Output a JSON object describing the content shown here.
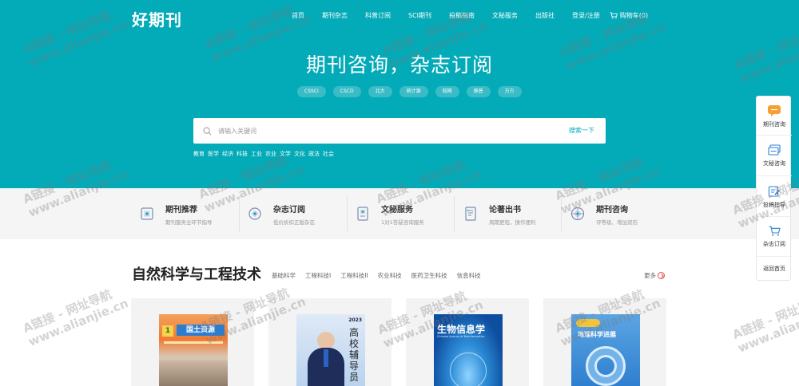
{
  "header": {
    "logo": "好期刊",
    "nav": [
      "首页",
      "期刊杂志",
      "科普订阅",
      "SCI期刊",
      "投稿指南",
      "文秘服务",
      "出版社",
      "登录/注册"
    ],
    "cart_label": "购物车(0)"
  },
  "hero": {
    "title": "期刊咨询，杂志订阅",
    "tags": [
      "CSSCI",
      "CSCD",
      "北大",
      "统计源",
      "知网",
      "维普",
      "万方"
    ],
    "search_placeholder": "请输入关键词",
    "search_button": "搜索一下",
    "hot_words": [
      "教育",
      "医学",
      "经济",
      "科技",
      "工业",
      "农业",
      "文学",
      "文化",
      "政法",
      "社会"
    ]
  },
  "services": [
    {
      "title": "期刊推荐",
      "desc": "期刊服务全环节指导"
    },
    {
      "title": "杂志订阅",
      "desc": "低价折扣正版杂志"
    },
    {
      "title": "文秘服务",
      "desc": "1对1答疑咨询服务"
    },
    {
      "title": "论著出书",
      "desc": "周期更短，操作便利"
    },
    {
      "title": "期刊咨询",
      "desc": "评等级、增加资历"
    }
  ],
  "section": {
    "title": "自然科学与工程技术",
    "tabs": [
      "基础科学",
      "工程科技I",
      "工程科技II",
      "农业科技",
      "医药卫生科技",
      "信息科技"
    ],
    "more": "更多"
  },
  "magazines": [
    {
      "cover_title": "国土资源",
      "cover_tag": "1"
    },
    {
      "cover_title": "高校辅导员",
      "cover_tag": "2023"
    },
    {
      "cover_title": "生物信息学",
      "cover_sub": "Chinese Journal of Bioinformatics"
    },
    {
      "cover_title": "地理科学进展"
    }
  ],
  "sidebar": [
    "期刊咨询",
    "文秘咨询",
    "投稿指导",
    "杂志订阅",
    "返回首页"
  ],
  "watermark": {
    "line1": "A链接 - 网址导航",
    "line2": "www.alianjie.cn"
  },
  "colors": {
    "primary": "#03aab8",
    "accent": "#e5484d",
    "service_bg": "#f5f5f5"
  }
}
